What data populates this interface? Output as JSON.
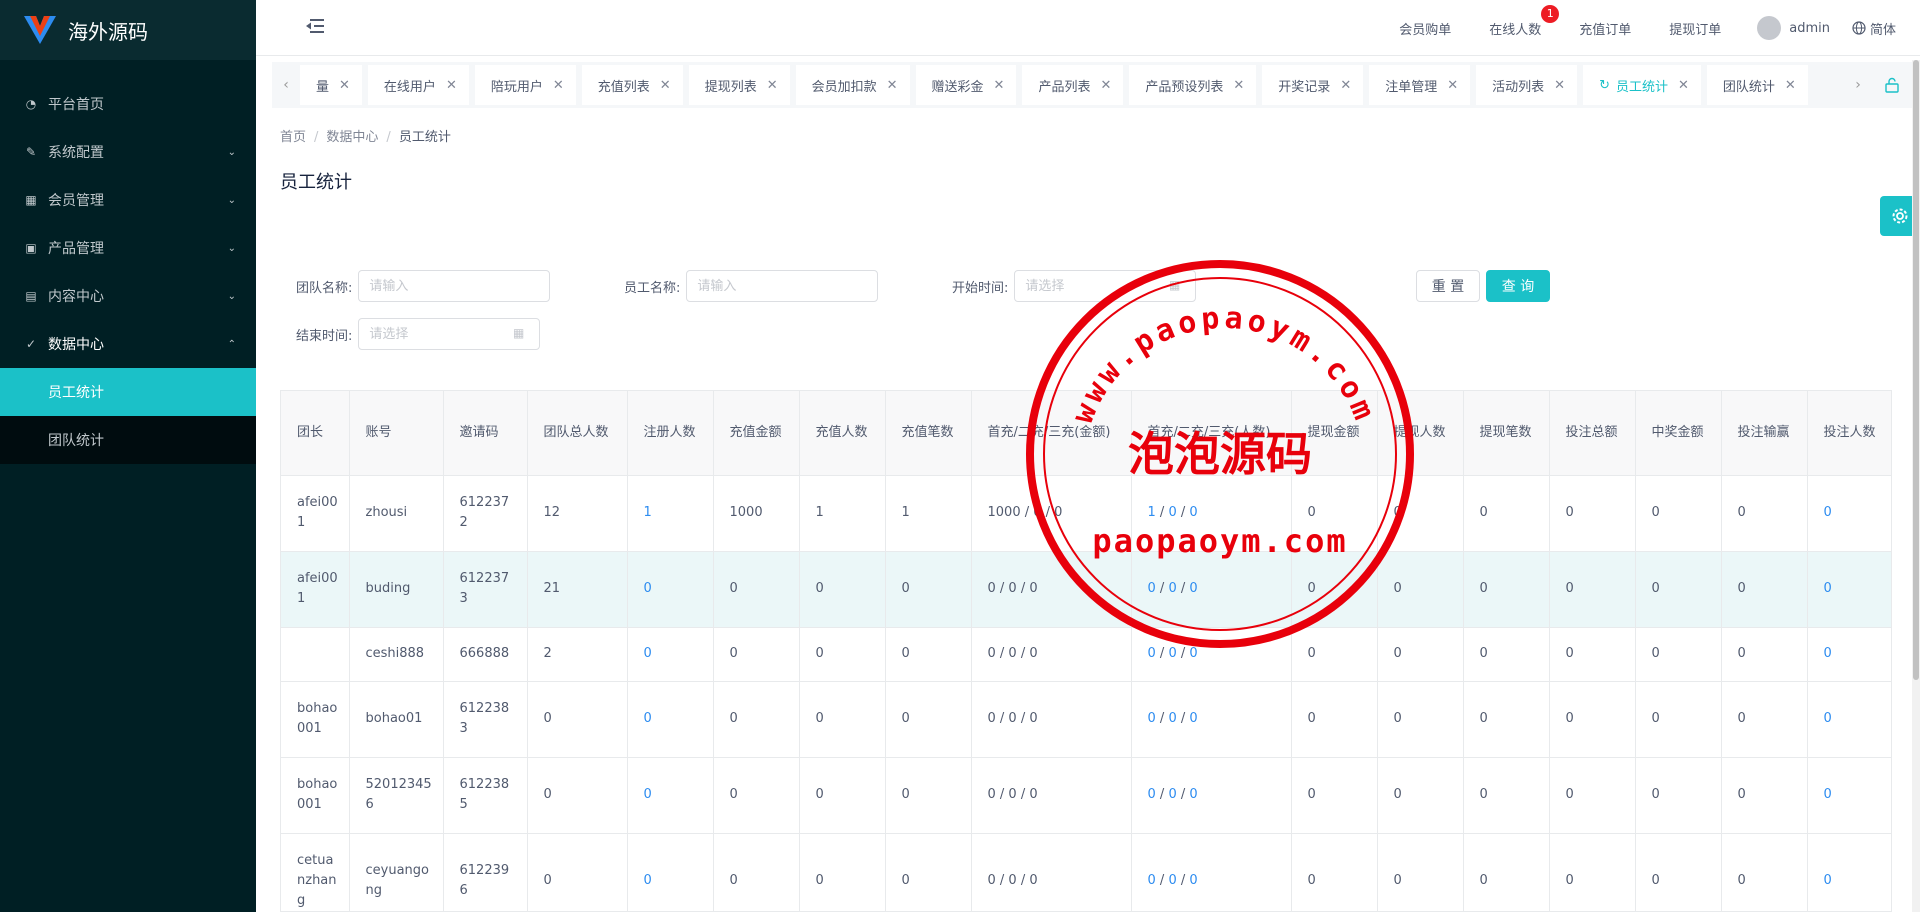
{
  "app": {
    "title": "海外源码",
    "brand_color": "#1bc1c8",
    "sidebar_bg": "#001f24"
  },
  "sidebar": {
    "items": [
      {
        "label": "平台首页",
        "icon": "dashboard-icon"
      },
      {
        "label": "系统配置",
        "icon": "edit-icon"
      },
      {
        "label": "会员管理",
        "icon": "table-icon"
      },
      {
        "label": "产品管理",
        "icon": "grid-icon"
      },
      {
        "label": "内容中心",
        "icon": "document-icon"
      },
      {
        "label": "数据中心",
        "icon": "check-circle-icon"
      }
    ],
    "sub_items": [
      {
        "label": "员工统计",
        "active": true
      },
      {
        "label": "团队统计",
        "active": false
      }
    ]
  },
  "header": {
    "links": [
      "会员购单",
      "在线人数",
      "充值订单",
      "提现订单"
    ],
    "online_badge": "1",
    "username": "admin",
    "language": "简体"
  },
  "tabs": [
    {
      "label": "量"
    },
    {
      "label": "在线用户"
    },
    {
      "label": "陪玩用户"
    },
    {
      "label": "充值列表"
    },
    {
      "label": "提现列表"
    },
    {
      "label": "会员加扣款"
    },
    {
      "label": "赠送彩金"
    },
    {
      "label": "产品列表"
    },
    {
      "label": "产品预设列表"
    },
    {
      "label": "开奖记录"
    },
    {
      "label": "注单管理"
    },
    {
      "label": "活动列表"
    },
    {
      "label": "员工统计",
      "active": true
    },
    {
      "label": "团队统计"
    }
  ],
  "breadcrumb": [
    "首页",
    "数据中心",
    "员工统计"
  ],
  "page_title": "员工统计",
  "filters": {
    "team_label": "团队名称:",
    "team_placeholder": "请输入",
    "staff_label": "员工名称:",
    "staff_placeholder": "请输入",
    "start_label": "开始时间:",
    "start_placeholder": "请选择",
    "end_label": "结束时间:",
    "end_placeholder": "请选择",
    "reset_label": "重 置",
    "query_label": "查 询"
  },
  "table": {
    "headers": [
      "团长",
      "账号",
      "邀请码",
      "团队总人数",
      "注册人数",
      "充值金额",
      "充值人数",
      "充值笔数",
      "首充/二充/三充(金额)",
      "首充/二充/三充(人数)",
      "提现金额",
      "提现人数",
      "提现笔数",
      "投注总额",
      "中奖金额",
      "投注输赢",
      "投注人数"
    ],
    "rows": [
      [
        "afei001",
        "zhousi",
        "6122372",
        "12",
        "1",
        "1000",
        "1",
        "1",
        "1000 / 0 / 0",
        "1",
        "0",
        "0",
        "0",
        "0",
        "0",
        "0",
        "0",
        "0",
        "0"
      ],
      [
        "afei001",
        "buding",
        "6122373",
        "21",
        "0",
        "0",
        "0",
        "0",
        "0 / 0 / 0",
        "0",
        "0",
        "0",
        "0",
        "0",
        "0",
        "0",
        "0",
        "0",
        "0"
      ],
      [
        "",
        "ceshi888",
        "666888",
        "2",
        "0",
        "0",
        "0",
        "0",
        "0 / 0 / 0",
        "0",
        "0",
        "0",
        "0",
        "0",
        "0",
        "0",
        "0",
        "0",
        "0"
      ],
      [
        "bohao001",
        "bohao01",
        "6122383",
        "0",
        "0",
        "0",
        "0",
        "0",
        "0 / 0 / 0",
        "0",
        "0",
        "0",
        "0",
        "0",
        "0",
        "0",
        "0",
        "0",
        "0"
      ],
      [
        "bohao001",
        "520123456",
        "6122385",
        "0",
        "0",
        "0",
        "0",
        "0",
        "0 / 0 / 0",
        "0",
        "0",
        "0",
        "0",
        "0",
        "0",
        "0",
        "0",
        "0",
        "0"
      ],
      [
        "cetuanzhang",
        "ceyuangong",
        "6122396",
        "0",
        "0",
        "0",
        "0",
        "0",
        "0 / 0 / 0",
        "0",
        "0",
        "0",
        "0",
        "0",
        "0",
        "0",
        "0",
        "0",
        "0"
      ]
    ]
  },
  "watermark": {
    "arc_text": "www.paopaoym.com",
    "center_text": "泡泡源码",
    "bottom_text": "paopaoym.com",
    "color": "#e8000b"
  }
}
